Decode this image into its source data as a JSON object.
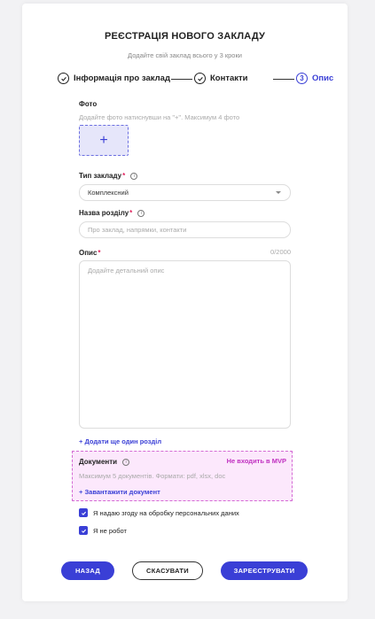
{
  "header": {
    "title": "РЕЄСТРАЦІЯ НОВОГО ЗАКЛАДУ",
    "subtitle": "Додайте свій заклад всього у 3 кроки"
  },
  "stepper": {
    "steps": [
      {
        "label": "Інформація про заклад",
        "state": "done"
      },
      {
        "label": "Контакти",
        "state": "done"
      },
      {
        "label": "Опис",
        "number": "3",
        "state": "active"
      }
    ]
  },
  "photo": {
    "label": "Фото",
    "hint": "Додайте фото натиснувши на \"+\". Максимум 4 фото",
    "add_symbol": "+"
  },
  "venue_type": {
    "label": "Тип закладу",
    "required_mark": "*",
    "value": "Комплексний"
  },
  "section_name": {
    "label": "Назва розділу",
    "required_mark": "*",
    "placeholder": "Про заклад, напрямки, контакти"
  },
  "description": {
    "label": "Опис",
    "required_mark": "*",
    "counter": "0/2000",
    "placeholder": "Додайте детальний опис"
  },
  "add_section_link": "+ Додати ще один розділ",
  "documents": {
    "label": "Документи",
    "badge": "Не входить в MVP",
    "hint": "Максимум 5 документів. Формати: pdf, xlsx, doc",
    "upload_link": "+ Завантажити документ"
  },
  "consents": [
    {
      "label": "Я надаю згоду на обробку персональних даних",
      "checked": true
    },
    {
      "label": "Я не робот",
      "checked": true
    }
  ],
  "buttons": {
    "back": "НАЗАД",
    "cancel": "СКАСУВАТИ",
    "register": "ЗАРЕЄСТРУВАТИ"
  },
  "colors": {
    "accent": "#3a3fd6",
    "required": "#e0245e",
    "mvp_badge": "#c030c0"
  }
}
